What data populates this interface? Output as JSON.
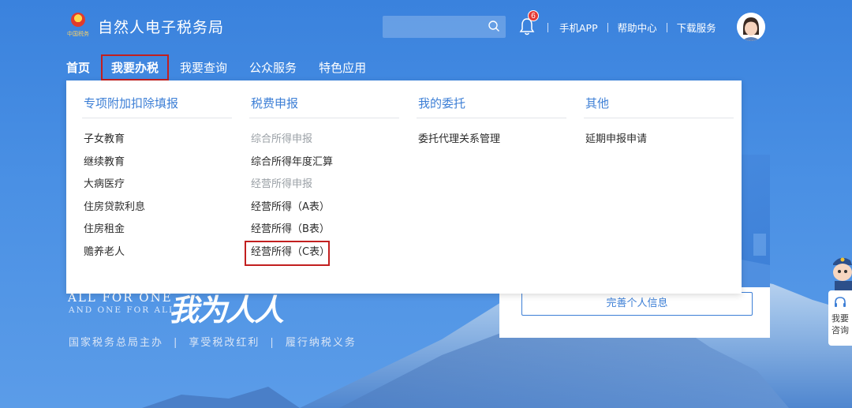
{
  "header": {
    "site_title": "自然人电子税务局",
    "emblem_tag": "中国税务",
    "search": {
      "placeholder": ""
    },
    "notification_count": "6",
    "links": [
      "手机APP",
      "帮助中心",
      "下载服务"
    ]
  },
  "nav": {
    "items": [
      "首页",
      "我要办税",
      "我要查询",
      "公众服务",
      "特色应用"
    ],
    "active_index": 0,
    "highlighted_index": 1
  },
  "dropdown": {
    "columns": [
      {
        "title": "专项附加扣除填报",
        "items": [
          "子女教育",
          "继续教育",
          "大病医疗",
          "住房贷款利息",
          "住房租金",
          "赡养老人"
        ]
      },
      {
        "title": "税费申报",
        "items": [
          {
            "text": "综合所得申报",
            "group": true
          },
          {
            "text": "综合所得年度汇算"
          },
          {
            "text": "经营所得申报",
            "group": true
          },
          {
            "text": "经营所得（A表）"
          },
          {
            "text": "经营所得（B表）"
          },
          {
            "text": "经营所得（C表）",
            "highlighted": true
          }
        ]
      },
      {
        "title": "我的委托",
        "items": [
          "委托代理关系管理"
        ]
      },
      {
        "title": "其他",
        "items": [
          "延期申报申请"
        ]
      }
    ]
  },
  "hero": {
    "tagline_line1": "ALL FOR ONE",
    "tagline_line2": "AND ONE FOR ALL",
    "calligraphy": "我为人人",
    "slogan": [
      "国家税务总局主办",
      "享受税改红利",
      "履行纳税义务"
    ]
  },
  "card": {
    "button_label": "完善个人信息"
  },
  "consult": {
    "line1": "我要",
    "line2": "咨询"
  },
  "colors": {
    "primary_blue": "#3d7fd6",
    "highlight_red": "#c21f1f",
    "badge_red": "#e53935"
  }
}
